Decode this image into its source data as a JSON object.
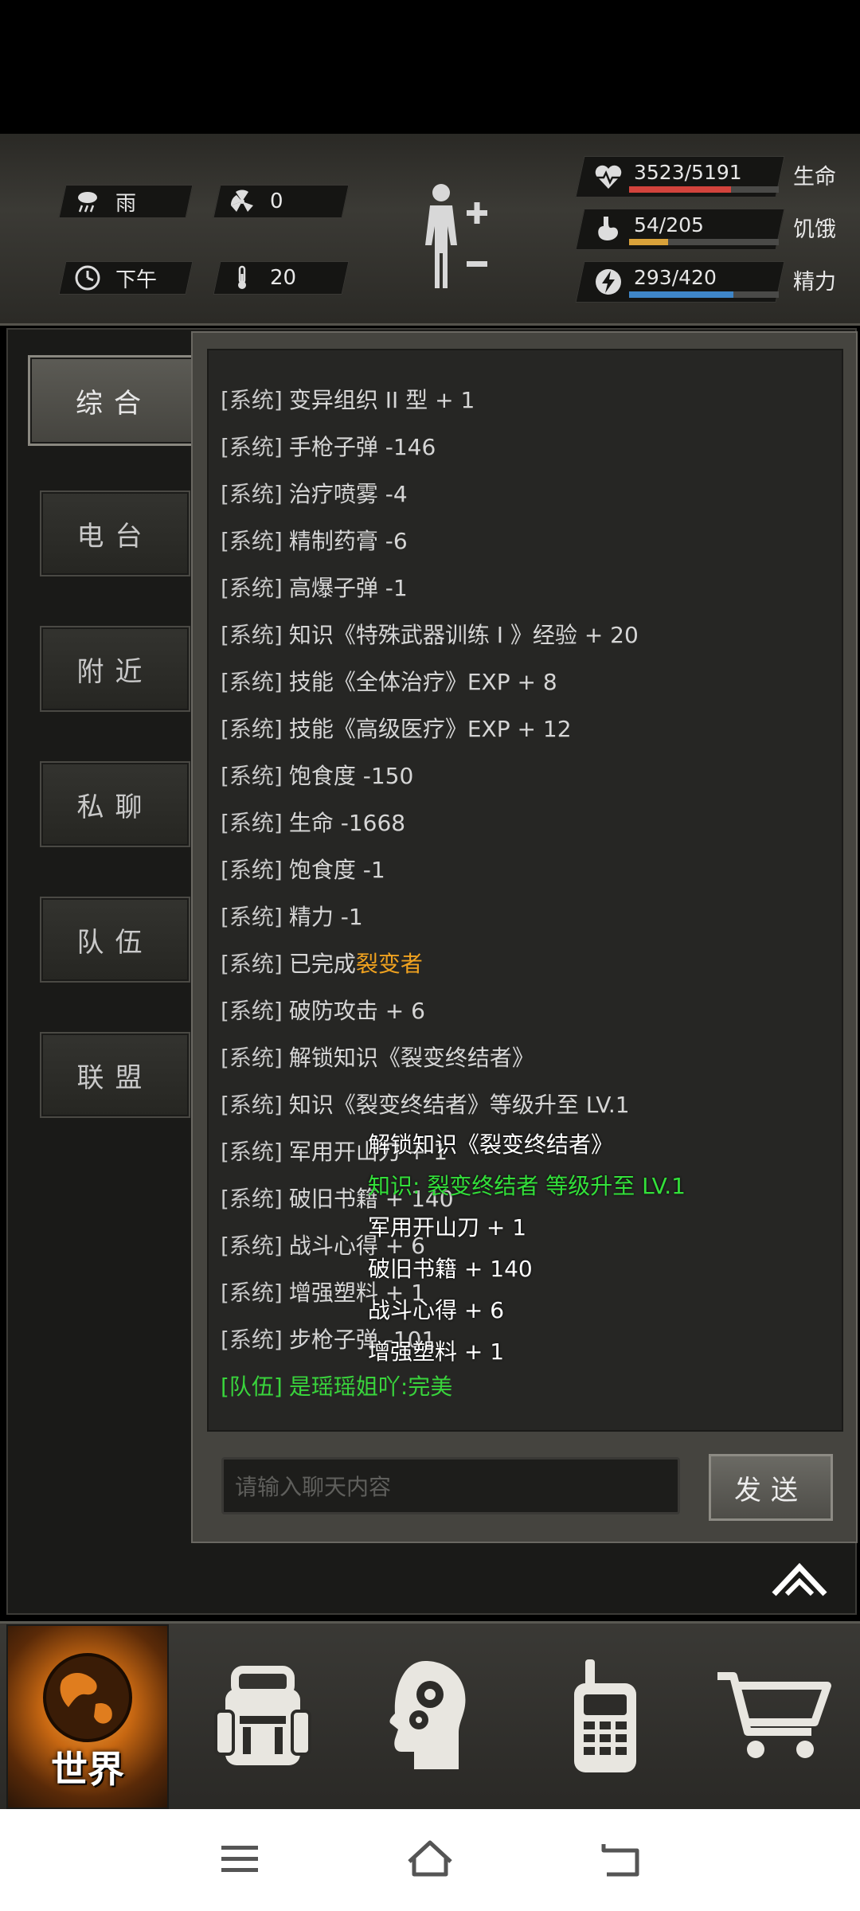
{
  "status": {
    "weather": "雨",
    "radiation": "0",
    "time_of_day": "下午",
    "temperature": "20"
  },
  "vitals": {
    "health": {
      "value": "3523/5191",
      "label": "生命",
      "fraction": 0.679,
      "color": "#d2433c"
    },
    "hunger": {
      "value": "54/205",
      "label": "饥饿",
      "fraction": 0.263,
      "color": "#d9a23a"
    },
    "energy": {
      "value": "293/420",
      "label": "精力",
      "fraction": 0.698,
      "color": "#3f86c8"
    }
  },
  "tabs": [
    "综合",
    "电台",
    "附近",
    "私聊",
    "队伍",
    "联盟"
  ],
  "chat": {
    "partial_top": "",
    "messages": [
      {
        "tag": "[系统]",
        "text": "变异组织 II 型 + 1"
      },
      {
        "tag": "[系统]",
        "text": "手枪子弹 -146"
      },
      {
        "tag": "[系统]",
        "text": "治疗喷雾 -4"
      },
      {
        "tag": "[系统]",
        "text": "精制药膏 -6"
      },
      {
        "tag": "[系统]",
        "text": "高爆子弹 -1"
      },
      {
        "tag": "[系统]",
        "text": "知识《特殊武器训练 I 》经验 + 20"
      },
      {
        "tag": "[系统]",
        "text": "技能《全体治疗》EXP + 8"
      },
      {
        "tag": "[系统]",
        "text": "技能《高级医疗》EXP + 12"
      },
      {
        "tag": "[系统]",
        "text": "饱食度 -150"
      },
      {
        "tag": "[系统]",
        "text": "生命 -1668"
      },
      {
        "tag": "[系统]",
        "text": "饱食度 -1"
      },
      {
        "tag": "[系统]",
        "text": "精力 -1"
      },
      {
        "tag": "[系统]",
        "text": "已完成",
        "highlight": "裂变者"
      },
      {
        "tag": "[系统]",
        "text": "破防攻击 + 6"
      },
      {
        "tag": "[系统]",
        "text": "解锁知识《裂变终结者》"
      },
      {
        "tag": "[系统]",
        "text": "知识《裂变终结者》等级升至 LV.1"
      },
      {
        "tag": "[系统]",
        "text": "军用开山刀 + 1"
      },
      {
        "tag": "[系统]",
        "text": "破旧书籍 + 140"
      },
      {
        "tag": "[系统]",
        "text": "战斗心得 + 6"
      },
      {
        "tag": "[系统]",
        "text": "增强塑料 + 1"
      },
      {
        "tag": "[系统]",
        "text": "步枪子弹 -101"
      },
      {
        "tag": "[队伍]",
        "text": "是瑶瑶姐吖:完美",
        "team": true
      }
    ],
    "popup": [
      {
        "text": "解锁知识《裂变终结者》",
        "green": false
      },
      {
        "text": "知识: 裂变终结者 等级升至 LV.1",
        "green": true
      },
      {
        "text": "军用开山刀 + 1",
        "green": false
      },
      {
        "text": "破旧书籍 + 140",
        "green": false
      },
      {
        "text": "战斗心得 + 6",
        "green": false
      },
      {
        "text": "增强塑料 + 1",
        "green": false
      }
    ],
    "input_placeholder": "请输入聊天内容",
    "send_label": "发送"
  },
  "bottom_nav": {
    "world_label": "世界",
    "items": [
      "world-icon",
      "backpack-icon",
      "skills-head-icon",
      "radio-icon",
      "shop-cart-icon"
    ]
  }
}
